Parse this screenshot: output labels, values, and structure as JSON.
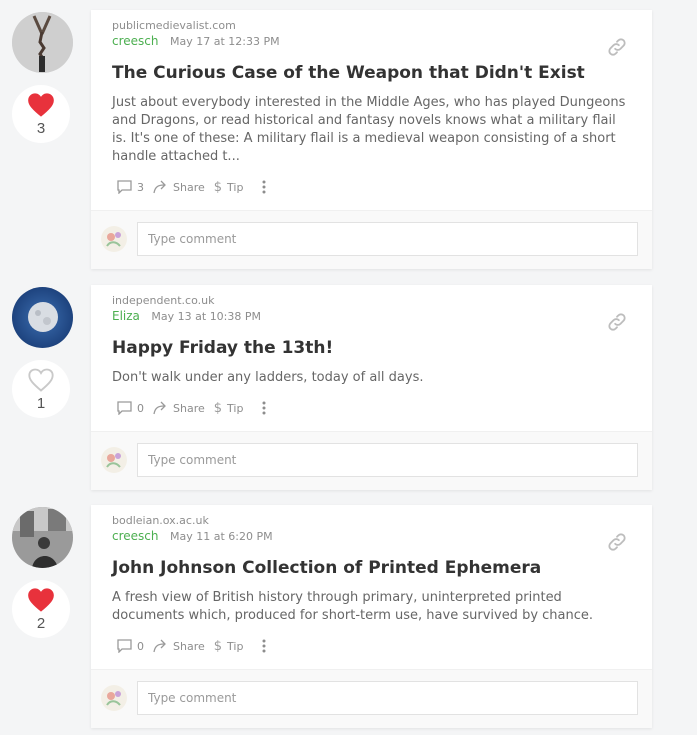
{
  "actions": {
    "share_label": "Share",
    "tip_label": "Tip"
  },
  "comment": {
    "placeholder": "Type comment"
  },
  "posts": [
    {
      "domain": "publicmedievalist.com",
      "author": "creesch",
      "date": "May 17 at 12:33 PM",
      "title": "The Curious Case of the Weapon that Didn't Exist",
      "excerpt": "Just about everybody interested in the Middle Ages, who has played Dungeons and Dragons, or read historical and fantasy novels knows what a military flail is. It's one of these: A military flail is a medieval weapon consisting of a short handle attached t...",
      "comments": "3",
      "likes": "3",
      "liked": true
    },
    {
      "domain": "independent.co.uk",
      "author": "Eliza",
      "date": "May 13 at 10:38 PM",
      "title": "Happy Friday the 13th!",
      "excerpt": "Don't walk under any ladders, today of all days.",
      "comments": "0",
      "likes": "1",
      "liked": false
    },
    {
      "domain": "bodleian.ox.ac.uk",
      "author": "creesch",
      "date": "May 11 at 6:20 PM",
      "title": "John Johnson Collection of Printed Ephemera",
      "excerpt": "A fresh view of British history through primary, uninterpreted printed documents which, produced for short-term use, have survived by chance.",
      "comments": "0",
      "likes": "2",
      "liked": true
    }
  ],
  "colors": {
    "heart_liked": "#e8323c",
    "heart_unliked": "#c9c9c9",
    "author": "#4caf50"
  }
}
